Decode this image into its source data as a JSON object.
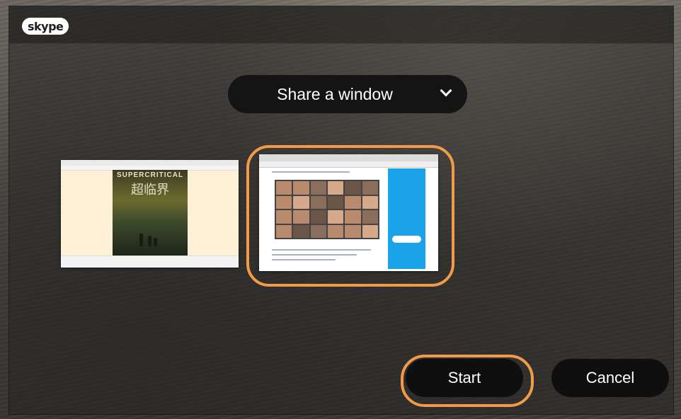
{
  "app": {
    "logo_text": "skype"
  },
  "share": {
    "mode_label": "Share a window"
  },
  "windows": [
    {
      "name": "window-thumbnail-book",
      "cover_title": "SUPERCRITICAL",
      "cover_subtitle": "超临界",
      "selected": false
    },
    {
      "name": "window-thumbnail-browser",
      "selected": true
    }
  ],
  "buttons": {
    "start_label": "Start",
    "cancel_label": "Cancel"
  },
  "colors": {
    "highlight": "#f09a4a",
    "button_bg": "#0f0f0f",
    "skype_blue": "#1aa3e8"
  }
}
